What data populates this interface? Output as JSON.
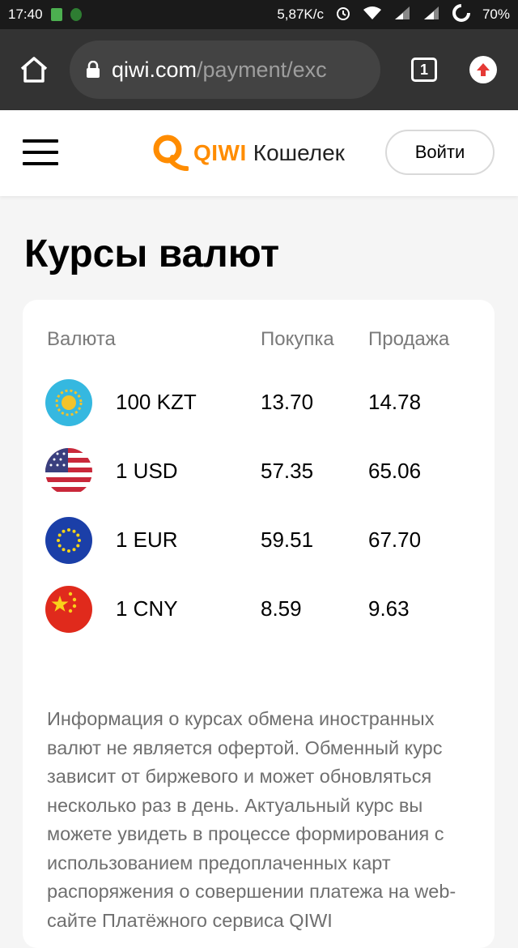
{
  "status_bar": {
    "time": "17:40",
    "speed": "5,87K/c",
    "battery": "70%"
  },
  "browser": {
    "url_domain": "qiwi.com",
    "url_path": "/payment/exc",
    "tab_count": "1"
  },
  "header": {
    "logo_word": "QIWI",
    "logo_sub": "Кошелек",
    "login_label": "Войти"
  },
  "page": {
    "title": "Курсы валют"
  },
  "rates": {
    "columns": {
      "currency": "Валюта",
      "buy": "Покупка",
      "sell": "Продажа"
    },
    "rows": [
      {
        "flag": "kazakhstan-flag-icon",
        "name": "100 KZT",
        "buy": "13.70",
        "sell": "14.78"
      },
      {
        "flag": "usa-flag-icon",
        "name": "1 USD",
        "buy": "57.35",
        "sell": "65.06"
      },
      {
        "flag": "eu-flag-icon",
        "name": "1 EUR",
        "buy": "59.51",
        "sell": "67.70"
      },
      {
        "flag": "china-flag-icon",
        "name": "1 CNY",
        "buy": "8.59",
        "sell": "9.63"
      }
    ]
  },
  "note": "Информация о курсах обмена иностранных валют не является офертой. Обменный курс зависит от биржевого и может обновляться несколько раз в день. Актуальный курс вы можете увидеть в процессе формирования с использованием предоплаченных карт распоряжения о совершении платежа на web-сайте Платёжного сервиса QIWI",
  "colors": {
    "brand_orange": "#ff8c00",
    "browser_bg": "#333333",
    "status_bg": "#1a1a1a",
    "page_bg": "#f5f5f5"
  }
}
